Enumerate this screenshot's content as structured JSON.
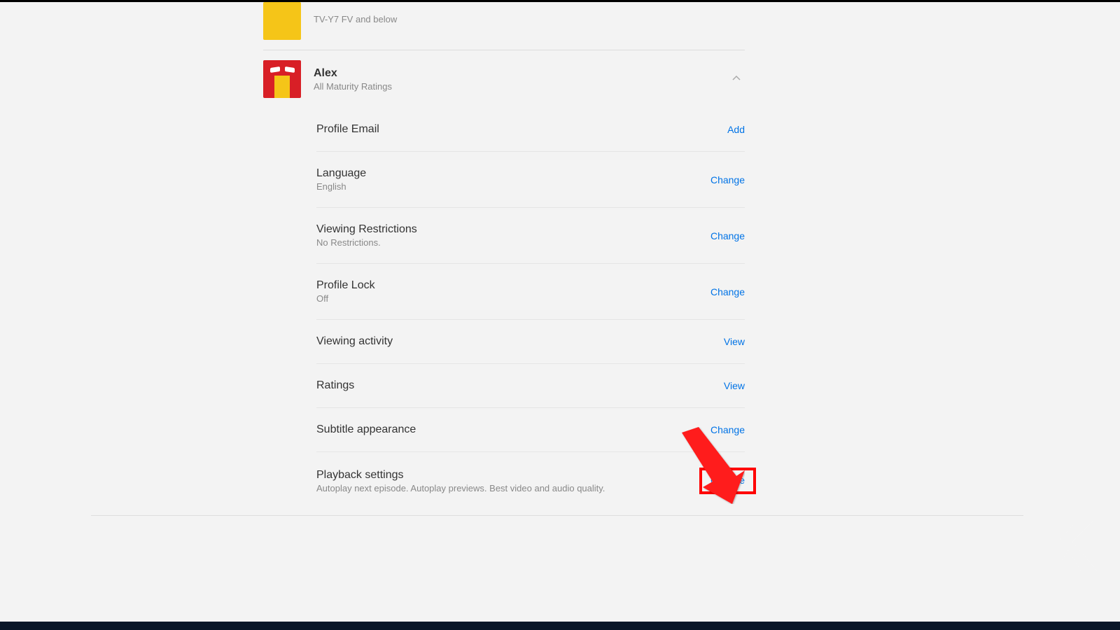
{
  "profiles": {
    "collapsed": {
      "sub": "TV-Y7 FV and below"
    },
    "expanded": {
      "name": "Alex",
      "sub": "All Maturity Ratings"
    }
  },
  "settings": [
    {
      "title": "Profile Email",
      "sub": "",
      "action": "Add"
    },
    {
      "title": "Language",
      "sub": "English",
      "action": "Change"
    },
    {
      "title": "Viewing Restrictions",
      "sub": "No Restrictions.",
      "action": "Change"
    },
    {
      "title": "Profile Lock",
      "sub": "Off",
      "action": "Change"
    },
    {
      "title": "Viewing activity",
      "sub": "",
      "action": "View"
    },
    {
      "title": "Ratings",
      "sub": "",
      "action": "View"
    },
    {
      "title": "Subtitle appearance",
      "sub": "",
      "action": "Change"
    },
    {
      "title": "Playback settings",
      "sub": "Autoplay next episode. Autoplay previews. Best video and audio quality.",
      "action": "Change"
    }
  ]
}
